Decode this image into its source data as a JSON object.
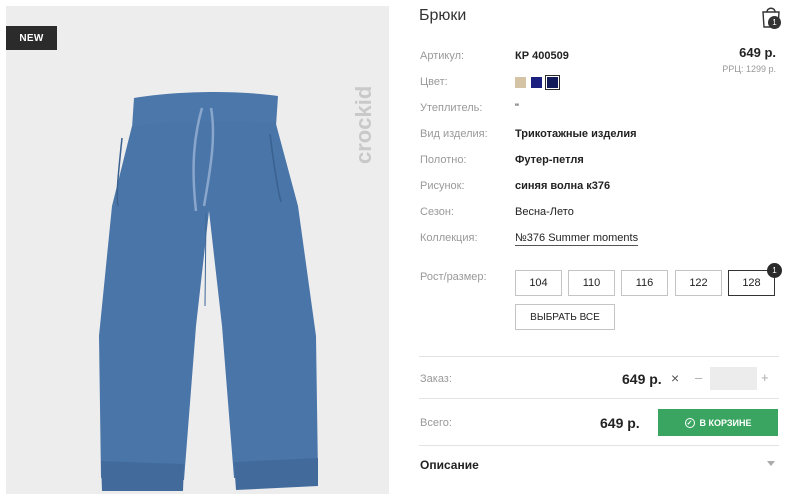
{
  "product": {
    "title": "Брюки",
    "badge": "NEW",
    "brand_watermark": "crockid",
    "cart_count": "1"
  },
  "details": [
    {
      "label": "Артикул:",
      "value": "КР 400509",
      "style": "bold"
    },
    {
      "label": "Цвет:",
      "value": "",
      "style": "swatches"
    },
    {
      "label": "Утеплитель:",
      "value": "\"",
      "style": "plain"
    },
    {
      "label": "Вид изделия:",
      "value": "Трикотажные изделия",
      "style": "bold"
    },
    {
      "label": "Полотно:",
      "value": "Футер-петля",
      "style": "bold"
    },
    {
      "label": "Рисунок:",
      "value": "синяя волна к376",
      "style": "bold"
    },
    {
      "label": "Сезон:",
      "value": "Весна-Лето",
      "style": "plain"
    },
    {
      "label": "Коллекция:",
      "value": "№376 Summer moments",
      "style": "link"
    }
  ],
  "price": {
    "current": "649 р.",
    "rrp": "РРЦ: 1299 р."
  },
  "colors": [
    {
      "name": "beige",
      "hex": "#d4c3a4",
      "selected": false
    },
    {
      "name": "navy",
      "hex": "#1b1f7e",
      "selected": false
    },
    {
      "name": "dark-navy",
      "hex": "#131a5a",
      "selected": true
    }
  ],
  "sizes": {
    "label": "Рост/размер:",
    "options": [
      "104",
      "110",
      "116",
      "122",
      "128"
    ],
    "selected": "128",
    "selected_count": "1",
    "select_all": "ВЫБРАТЬ ВСЕ"
  },
  "order": {
    "label": "Заказ:",
    "price": "649 р.",
    "times": "×",
    "minus": "–",
    "plus": "+",
    "qty": ""
  },
  "total": {
    "label": "Всего:",
    "price": "649 р.",
    "button": "В КОРЗИНЕ"
  },
  "description": {
    "label": "Описание"
  }
}
